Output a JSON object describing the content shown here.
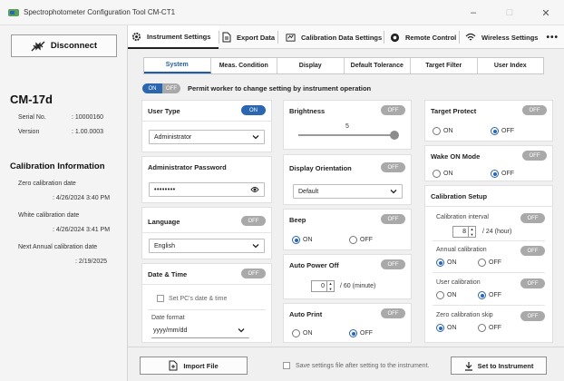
{
  "window": {
    "title": "Spectrophotometer Configuration Tool CM-CT1",
    "controls": [
      "–",
      "□",
      "✕"
    ]
  },
  "sidebar": {
    "disconnect_label": "Disconnect",
    "model": "CM-17d",
    "serial_label": "Serial No.",
    "serial_value": ": 10000160",
    "version_label": "Version",
    "version_value": ": 1.00.0003",
    "cal_heading": "Calibration Information",
    "zero_label": "Zero calibration date",
    "zero_value": ": 4/26/2024 3:40 PM",
    "white_label": "White calibration date",
    "white_value": ": 4/26/2024 3:41 PM",
    "next_label": "Next Annual calibration date",
    "next_value": ": 2/19/2025"
  },
  "tabs": {
    "instrument": "Instrument Settings",
    "export": "Export Data",
    "calibration": "Calibration Data Settings",
    "remote": "Remote Control",
    "wireless": "Wireless Settings",
    "more": "•••"
  },
  "subtabs": [
    "System",
    "Meas. Condition",
    "Display",
    "Default Tolerance",
    "Target Filter",
    "User Index"
  ],
  "permission": {
    "on": "ON",
    "off": "OFF",
    "text": "Permit worker to change setting by instrument operation"
  },
  "user_type": {
    "title": "User Type",
    "toggle": "ON",
    "value": "Administrator"
  },
  "admin_password": {
    "title": "Administrator Password",
    "value": "••••••••"
  },
  "language": {
    "title": "Language",
    "toggle": "OFF",
    "value": "English"
  },
  "date_time": {
    "title": "Date & Time",
    "toggle": "OFF",
    "checkbox_label": "Set PC's date & time",
    "format_label": "Date format",
    "format_value": "yyyy/mm/dd"
  },
  "brightness": {
    "title": "Brightness",
    "toggle": "OFF",
    "value": "5",
    "level": 1.0
  },
  "orientation": {
    "title": "Display Orientation",
    "toggle": "OFF",
    "value": "Default"
  },
  "beep": {
    "title": "Beep",
    "toggle": "OFF",
    "on": "ON",
    "off": "OFF",
    "selected": "ON"
  },
  "auto_power": {
    "title": "Auto Power Off",
    "toggle": "OFF",
    "value": "0",
    "unit": "/ 60 (minute)"
  },
  "auto_print": {
    "title": "Auto Print",
    "toggle": "OFF",
    "on": "ON",
    "off": "OFF",
    "selected": "OFF"
  },
  "target_protect": {
    "title": "Target Protect",
    "toggle": "OFF",
    "on": "ON",
    "off": "OFF",
    "selected": "OFF"
  },
  "wake_on": {
    "title": "Wake ON Mode",
    "toggle": "OFF",
    "on": "ON",
    "off": "OFF",
    "selected": "OFF"
  },
  "cal_setup": {
    "title": "Calibration Setup",
    "interval_label": "Calibration interval",
    "interval_toggle": "OFF",
    "interval_value": "8",
    "interval_unit": "/ 24 (hour)",
    "annual_label": "Annual calibration",
    "annual_toggle": "OFF",
    "annual_selected": "ON",
    "user_label": "User calibration",
    "user_toggle": "OFF",
    "user_selected": "OFF",
    "zero_skip_label": "Zero calibration skip",
    "zero_skip_toggle": "OFF",
    "zero_skip_selected": "ON",
    "on": "ON",
    "off": "OFF"
  },
  "bottom": {
    "import_label": "Import File",
    "save_checkbox_label": "Save settings file after setting to the instrument.",
    "set_label": "Set to Instrument"
  }
}
